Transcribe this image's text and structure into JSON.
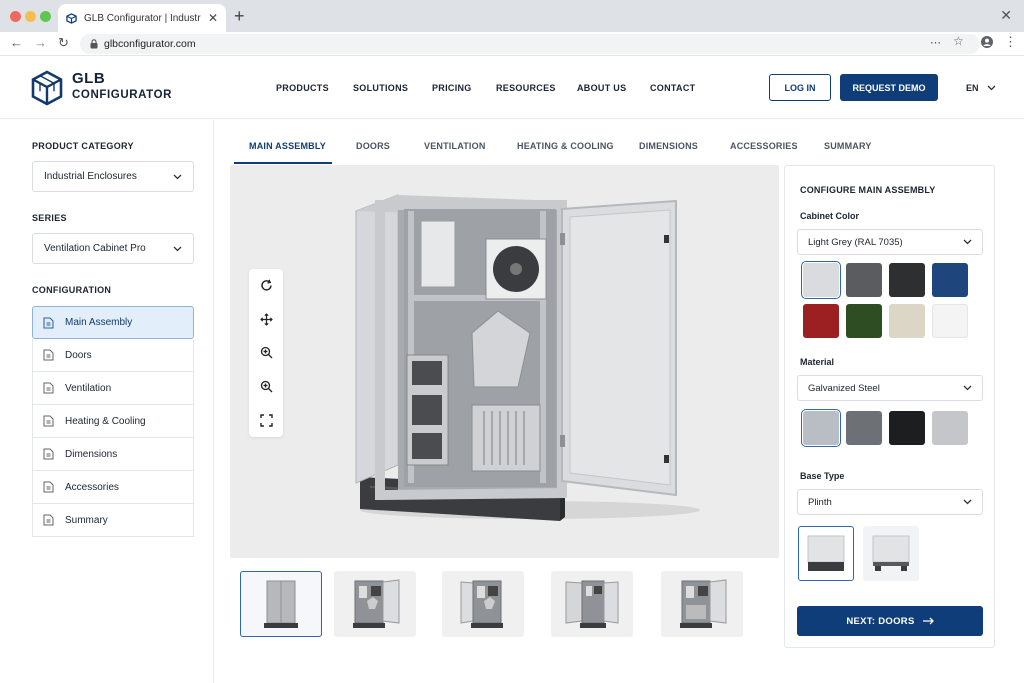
{
  "browser": {
    "tab_title": "GLB Configurator | Industrial Prod",
    "url": "glbconfigurator.com"
  },
  "header": {
    "logo_line1": "GLB",
    "logo_line2": "CONFIGURATOR",
    "nav": [
      "PRODUCTS",
      "SOLUTIONS",
      "PRICING",
      "RESOURCES",
      "ABOUT US",
      "CONTACT"
    ],
    "login_label": "LOG IN",
    "demo_label": "REQUEST DEMO",
    "language": "EN",
    "accent_color": "#0f3d79"
  },
  "sidebar": {
    "category_heading": "PRODUCT CATEGORY",
    "category_value": "Industrial Enclosures",
    "series_heading": "SERIES",
    "series_value": "Ventilation Cabinet Pro",
    "config_heading": "CONFIGURATION",
    "items": [
      "Main Assembly",
      "Doors",
      "Ventilation",
      "Heating & Cooling",
      "Dimensions",
      "Accessories",
      "Summary"
    ],
    "active_item": "Main Assembly"
  },
  "tabs": {
    "items": [
      "MAIN ASSEMBLY",
      "DOORS",
      "VENTILATION",
      "HEATING & COOLING",
      "DIMENSIONS",
      "ACCESSORIES",
      "SUMMARY"
    ],
    "active": "MAIN ASSEMBLY"
  },
  "viewer": {
    "tools": [
      "rotate-icon",
      "pan-icon",
      "zoom-in-icon",
      "zoom-out-icon",
      "fullscreen-icon"
    ],
    "thumbnail_count": 5,
    "active_thumbnail": 0
  },
  "panel": {
    "title": "CONFIGURE MAIN ASSEMBLY",
    "color_label": "Cabinet Color",
    "color_value": "Light Grey (RAL 7035)",
    "color_swatches": [
      "#d9dbde",
      "#5a5c5f",
      "#2e2f31",
      "#1e467c",
      "#9c1f22",
      "#2f4d22",
      "#dcd6c6",
      "#f4f4f4"
    ],
    "selected_color": 0,
    "material_label": "Material",
    "material_value": "Galvanized Steel",
    "material_swatches": [
      "#b9bec4",
      "#6d7075",
      "#1d1e20",
      "#c4c6c9"
    ],
    "selected_material": 0,
    "base_label": "Base Type",
    "base_value": "Plinth",
    "base_options": [
      "plinth",
      "feet"
    ],
    "selected_base": 0,
    "next_label": "NEXT: DOORS"
  }
}
